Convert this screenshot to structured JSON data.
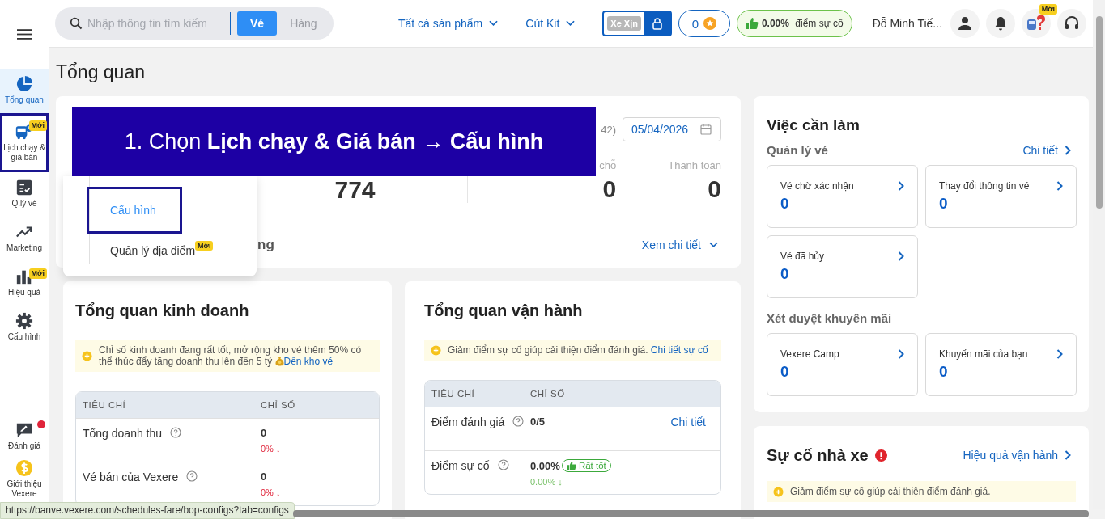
{
  "sidebar": {
    "items": [
      {
        "label": "Tổng quan",
        "selected": true,
        "highlighted": false
      },
      {
        "label": "Lịch chạy & giá bán",
        "badge": "Mới",
        "selected": false,
        "highlighted": true
      },
      {
        "label": "Q.lý vé",
        "selected": false,
        "highlighted": false
      },
      {
        "label": "Marketing",
        "selected": false,
        "highlighted": false
      },
      {
        "label": "Hiệu quả",
        "badge": "Mới",
        "selected": false,
        "highlighted": false
      },
      {
        "label": "Cấu hình",
        "selected": false,
        "highlighted": false
      }
    ],
    "bottom_items": [
      {
        "label": "Đánh giá",
        "dot": true
      },
      {
        "label": "Giới thiệu Vexere",
        "dot": false
      }
    ]
  },
  "header": {
    "search": {
      "placeholder": "Nhập thông tin tìm kiếm"
    },
    "tabs": [
      {
        "label": "Vé",
        "selected": true
      },
      {
        "label": "Hàng",
        "selected": false
      }
    ],
    "menus": [
      "Tất cả sản phẩm",
      "Cút Kit"
    ],
    "tier": "Xe Xịn",
    "points": "0",
    "incident": {
      "value": "0.00%",
      "label": "điểm sự cố"
    },
    "user_name": "Đỗ Minh Tiế...",
    "mascot_badge": "Mới"
  },
  "page_title": "Tổng quan",
  "overview": {
    "period_fragment": "42)",
    "date": "05/04/2026",
    "stats": [
      {
        "value": "774"
      },
      {
        "label": "chỗ",
        "value": "0"
      },
      {
        "label": "Thanh toán",
        "value": "0"
      }
    ],
    "section_fragment": "ng",
    "detail_link": "Xem chi tiết"
  },
  "dropdown": {
    "items": [
      {
        "label": "Cấu hình",
        "selected": true,
        "highlighted": true
      },
      {
        "label": "Quản lý địa điểm",
        "badge": "Mới",
        "selected": false,
        "highlighted": false
      }
    ]
  },
  "tutorial": {
    "text": "1. Chọn **Lịch chạy & Giá bán → Cấu hình**"
  },
  "business": {
    "title": "Tổng quan kinh doanh",
    "notice": {
      "text": "Chỉ số kinh doanh đang rất tốt, mở rộng kho vé thêm 50% có thể thúc đẩy tăng doanh thu lên đến 5 tỷ",
      "link": "Đến kho vé"
    },
    "columns": [
      "TIÊU CHÍ",
      "CHỈ SỐ"
    ],
    "rows": [
      {
        "label": "Tổng doanh thu",
        "value": "0",
        "change": "0% ↓",
        "negative": true
      },
      {
        "label": "Vé bán của Vexere",
        "value": "0",
        "change": "0% ↓",
        "negative": true
      }
    ]
  },
  "operations": {
    "title": "Tổng quan vận hành",
    "notice": {
      "text": "Giảm điểm sự cố giúp cải thiện điểm đánh giá.",
      "link": "Chi tiết sự cố"
    },
    "columns": [
      "TIÊU CHÍ",
      "CHỈ SỐ"
    ],
    "rows": [
      {
        "label": "Điểm đánh giá",
        "value": "0/5",
        "link": "Chi tiết"
      },
      {
        "label": "Điểm sự cố",
        "value": "0.00%",
        "badge": "Rất tốt",
        "change": "0.00% ↓",
        "negative": false
      }
    ]
  },
  "todo": {
    "title": "Việc cần làm",
    "groups": [
      {
        "title": "Quản lý vé",
        "link": "Chi tiết",
        "tiles": [
          {
            "label": "Vé chờ xác nhận",
            "value": "0"
          },
          {
            "label": "Thay đổi thông tin vé",
            "value": "0"
          },
          {
            "label": "Vé đã hủy",
            "value": "0"
          }
        ]
      },
      {
        "title": "Xét duyệt khuyến mãi",
        "tiles": [
          {
            "label": "Vexere Camp",
            "value": "0"
          },
          {
            "label": "Khuyến mãi của bạn",
            "value": "0"
          }
        ]
      }
    ]
  },
  "incidents": {
    "title": "Sự cố nhà xe",
    "link": "Hiệu quả vận hành",
    "notice": "Giảm điểm sự cố giúp cải thiện điểm đánh giá."
  },
  "status_url": "https://banve.vexere.com/schedules-fare/bop-configs?tab=configs"
}
